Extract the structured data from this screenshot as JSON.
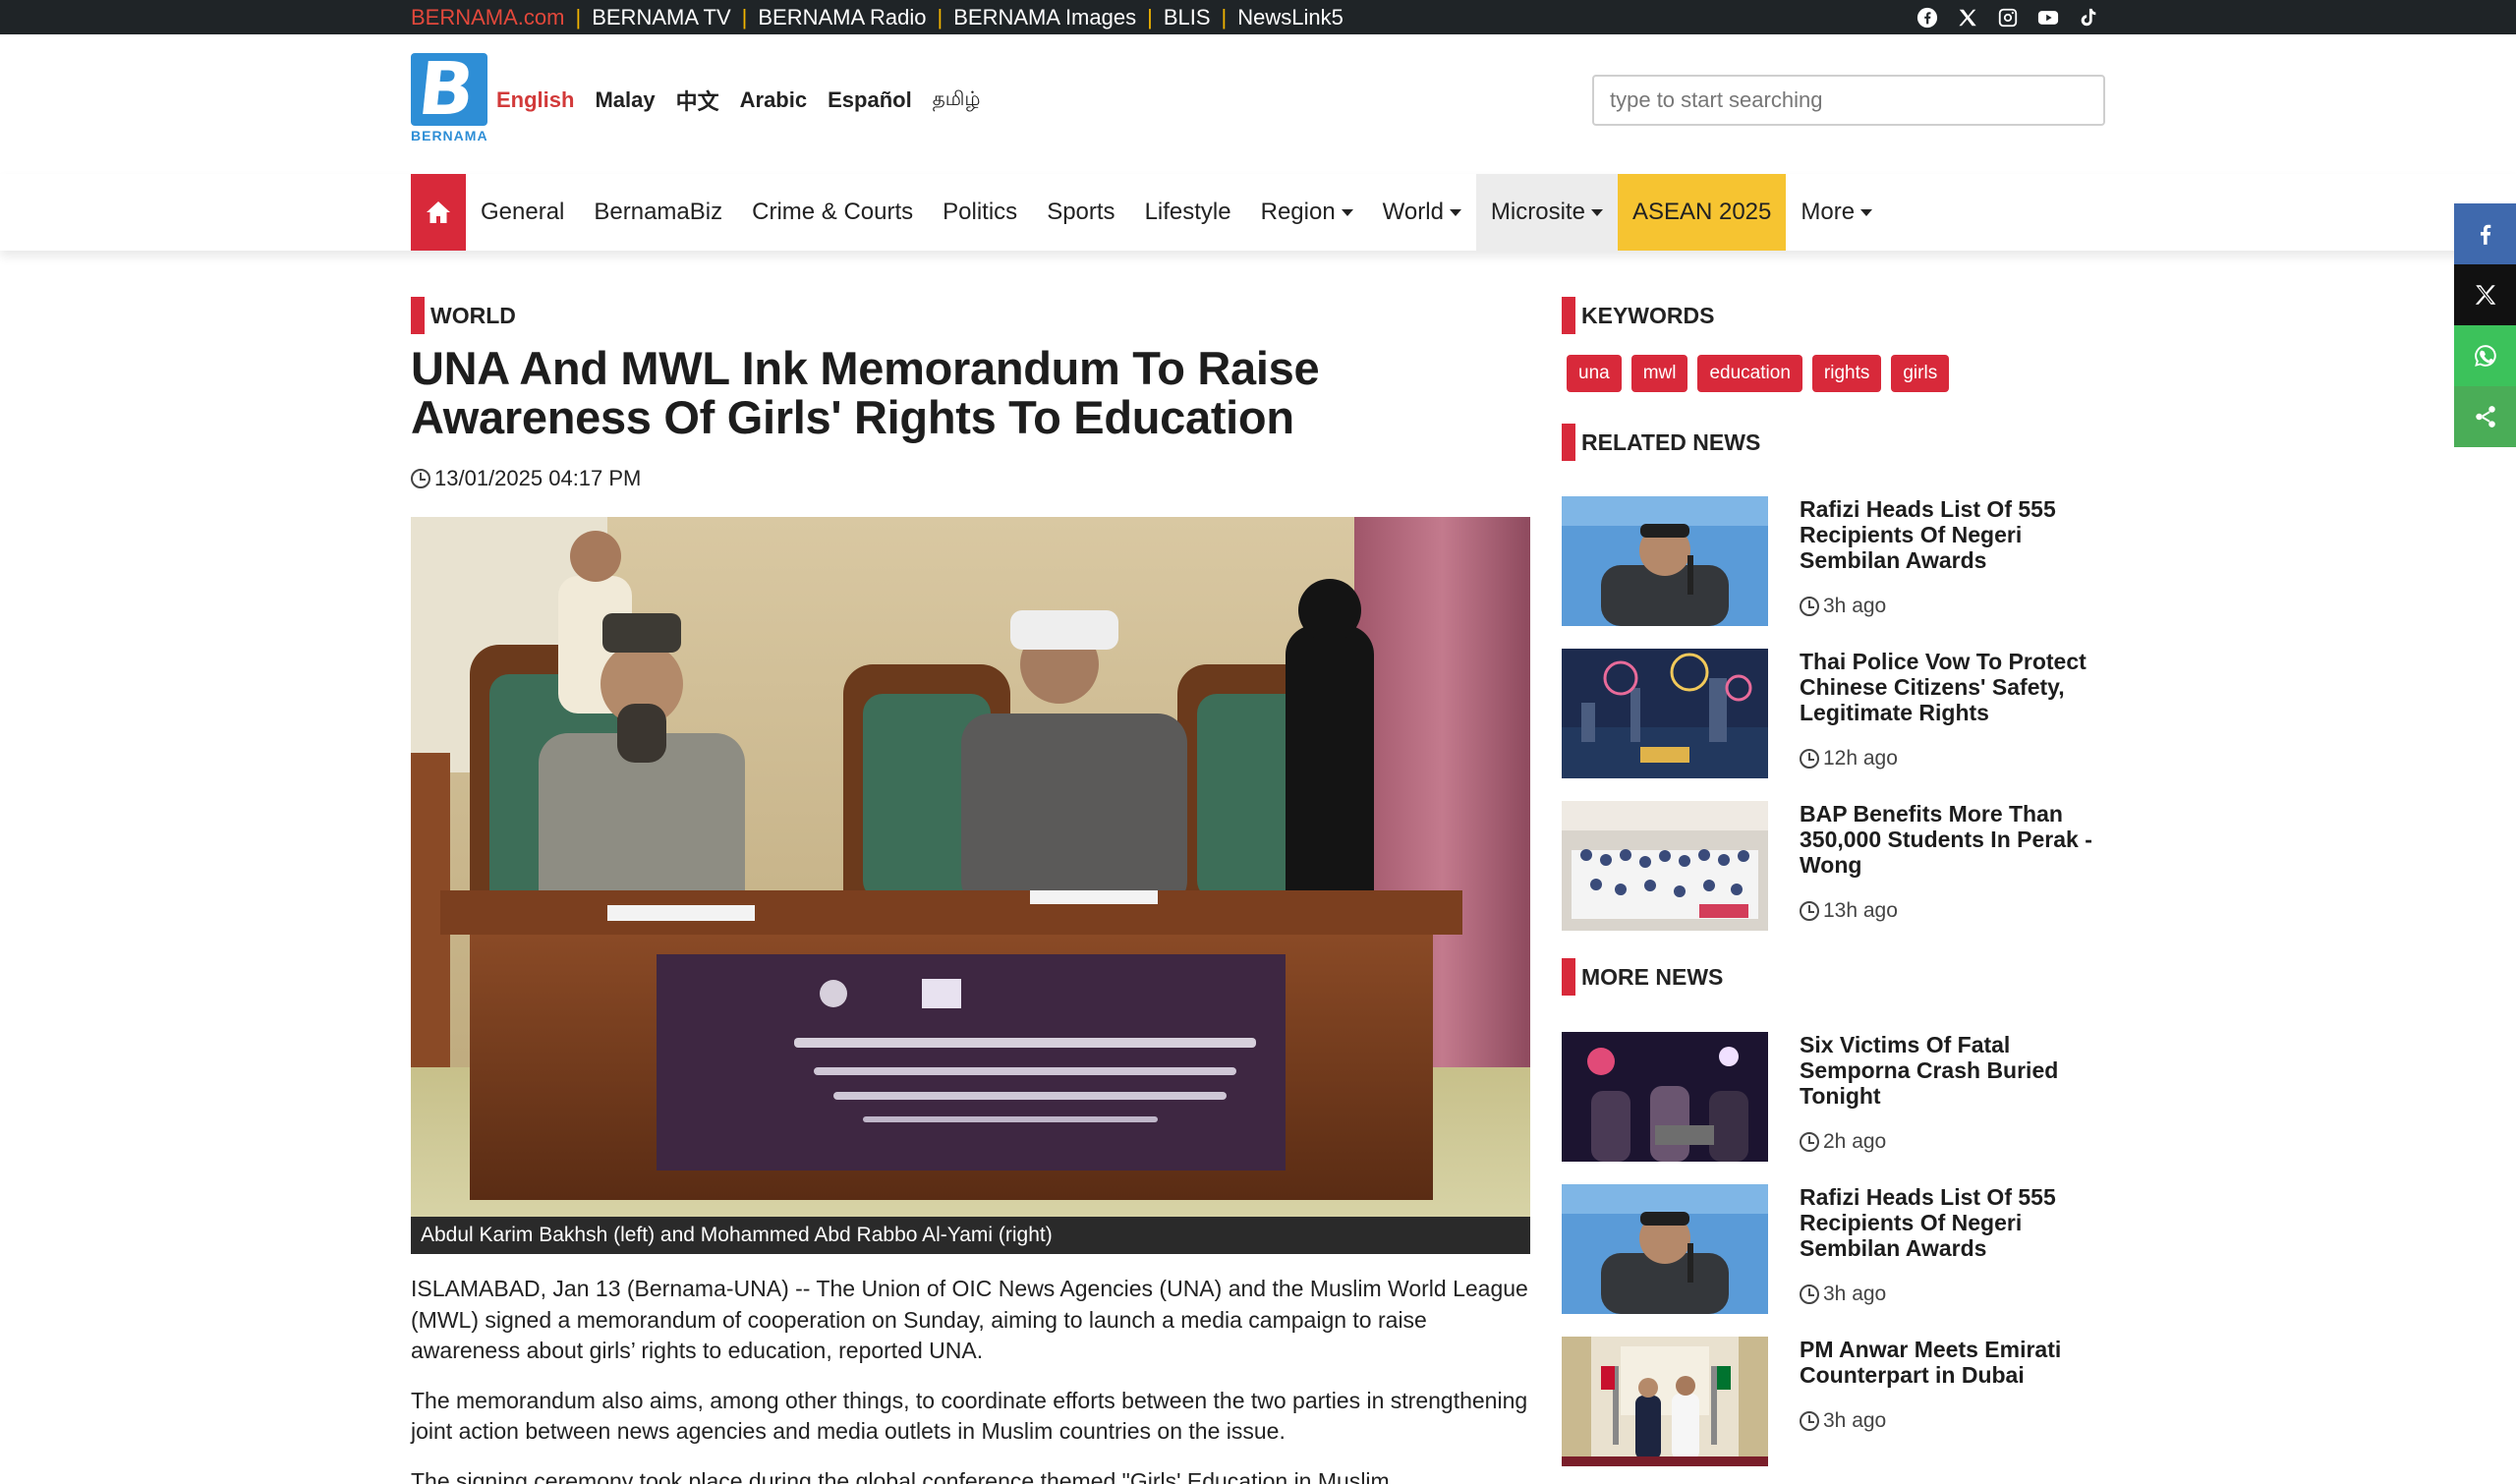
{
  "topbar": {
    "links": [
      "BERNAMA.com",
      "BERNAMA TV",
      "BERNAMA Radio",
      "BERNAMA Images",
      "BLIS",
      "NewsLink5"
    ],
    "social_icons": [
      "facebook-icon",
      "x-icon",
      "instagram-icon",
      "youtube-icon",
      "tiktok-icon"
    ]
  },
  "header": {
    "logo_text": "BERNAMA",
    "languages": [
      "English",
      "Malay",
      "中文",
      "Arabic",
      "Español",
      "தமிழ்"
    ],
    "active_language": "English",
    "search_placeholder": "type to start searching"
  },
  "nav": {
    "items": [
      {
        "label": "General"
      },
      {
        "label": "BernamaBiz"
      },
      {
        "label": "Crime & Courts"
      },
      {
        "label": "Politics"
      },
      {
        "label": "Sports"
      },
      {
        "label": "Lifestyle"
      },
      {
        "label": "Region"
      },
      {
        "label": "World"
      },
      {
        "label": "Microsite"
      },
      {
        "label": "ASEAN 2025"
      },
      {
        "label": "More"
      }
    ]
  },
  "colors": {
    "accent_red": "#d8293a",
    "asean_yellow": "#f6c431",
    "topbar_bg": "#1f2427"
  },
  "article": {
    "category": "WORLD",
    "title": "UNA And MWL Ink Memorandum To Raise Awareness Of Girls' Rights To Education",
    "datetime": "13/01/2025 04:17 PM",
    "photo_caption": "Abdul Karim Bakhsh (left) and Mohammed Abd Rabbo Al-Yami (right)",
    "paragraphs": [
      "ISLAMABAD, Jan 13 (Bernama-UNA) -- The Union of OIC News Agencies (UNA) and the Muslim World League (MWL) signed a memorandum of cooperation on Sunday, aiming to launch a media campaign to raise awareness about girls’ rights to education, reported UNA.",
      "The memorandum also aims, among other things, to coordinate efforts between the two parties in strengthening joint action between news agencies and media outlets in Muslim countries on the issue.",
      "The signing ceremony took place during the global conference themed \"Girls' Education in Muslim"
    ]
  },
  "sidebar": {
    "keywords_label": "KEYWORDS",
    "keywords": [
      "una",
      "mwl",
      "education",
      "rights",
      "girls"
    ],
    "related_label": "RELATED NEWS",
    "related": [
      {
        "title": "Rafizi Heads List Of 555 Recipients Of Negeri Sembilan Awards",
        "ago": "3h ago"
      },
      {
        "title": "Thai Police Vow To Protect Chinese Citizens' Safety, Legitimate Rights",
        "ago": "12h ago"
      },
      {
        "title": "BAP Benefits More Than 350,000 Students In Perak - Wong",
        "ago": "13h ago"
      }
    ],
    "more_label": "MORE NEWS",
    "more": [
      {
        "title": "Six Victims Of Fatal Semporna Crash Buried Tonight",
        "ago": "2h ago"
      },
      {
        "title": "Rafizi Heads List Of 555 Recipients Of Negeri Sembilan Awards",
        "ago": "3h ago"
      },
      {
        "title": "PM Anwar Meets Emirati Counterpart in Dubai",
        "ago": "3h ago"
      }
    ]
  },
  "share": [
    "facebook-icon",
    "x-icon",
    "whatsapp-icon",
    "share-icon"
  ]
}
